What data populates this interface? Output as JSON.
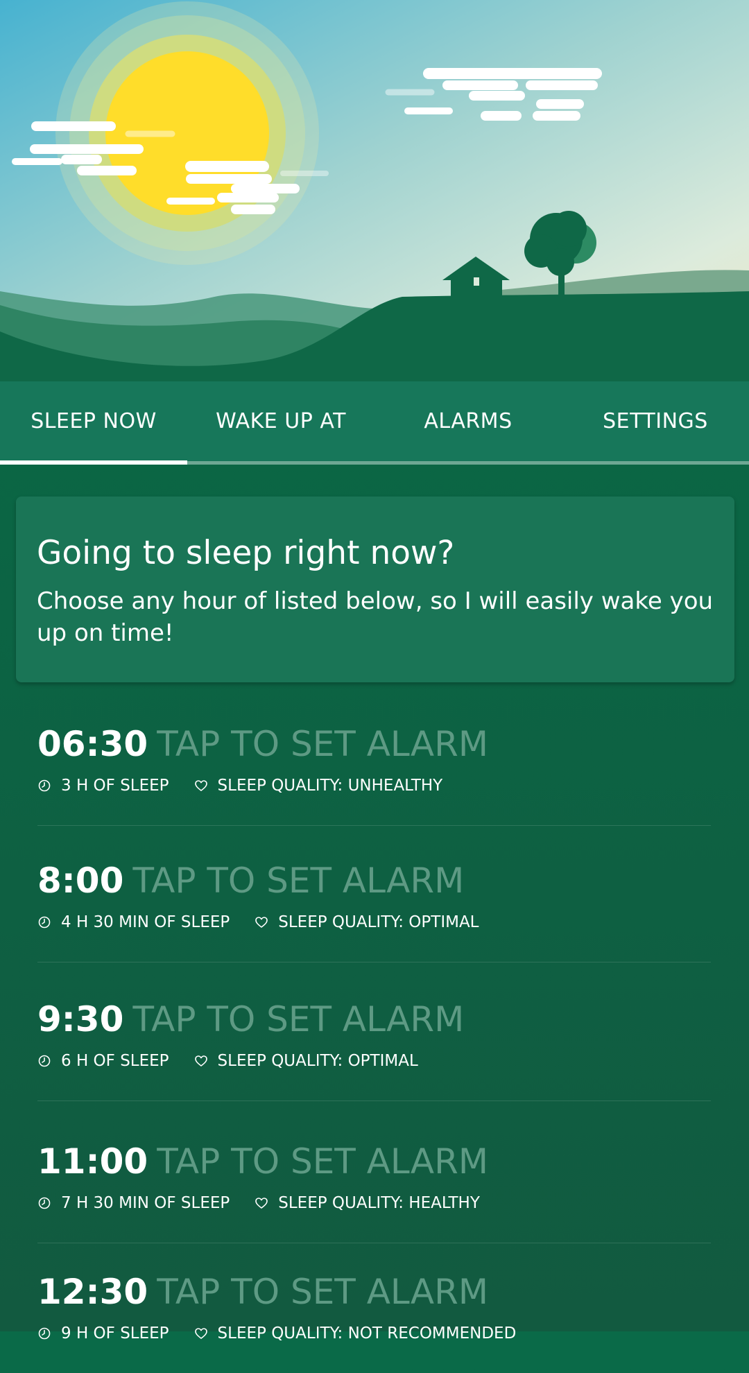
{
  "tabs": [
    {
      "label": "SLEEP NOW",
      "active": true
    },
    {
      "label": "WAKE UP AT",
      "active": false
    },
    {
      "label": "ALARMS",
      "active": false
    },
    {
      "label": "SETTINGS",
      "active": false
    }
  ],
  "intro": {
    "title": "Going to sleep right now?",
    "text": "Choose any hour of listed below, so I will easily wake you up on time!"
  },
  "alarms": [
    {
      "time": "06:30",
      "cta": "TAP TO SET ALARM",
      "duration": "3 H OF SLEEP",
      "quality": "SLEEP QUALITY: UNHEALTHY"
    },
    {
      "time": "8:00",
      "cta": "TAP TO SET ALARM",
      "duration": "4 H 30 MIN OF SLEEP",
      "quality": "SLEEP QUALITY: OPTIMAL"
    },
    {
      "time": "9:30",
      "cta": "TAP TO SET ALARM",
      "duration": "6 H OF SLEEP",
      "quality": "SLEEP QUALITY: OPTIMAL"
    },
    {
      "time": "11:00",
      "cta": "TAP TO SET ALARM",
      "duration": "7 H 30 MIN OF SLEEP",
      "quality": "SLEEP QUALITY: HEALTHY"
    },
    {
      "time": "12:30",
      "cta": "TAP TO SET ALARM",
      "duration": "9 H OF SLEEP",
      "quality": "SLEEP QUALITY: NOT RECOMMENDED"
    }
  ],
  "icons": {
    "duration": "clock-icon",
    "quality": "heart-icon"
  },
  "colors": {
    "accent": "#17775a",
    "background": "#0b6544",
    "sun": "#ffdd2a",
    "cta_text": "#5e9a84"
  }
}
